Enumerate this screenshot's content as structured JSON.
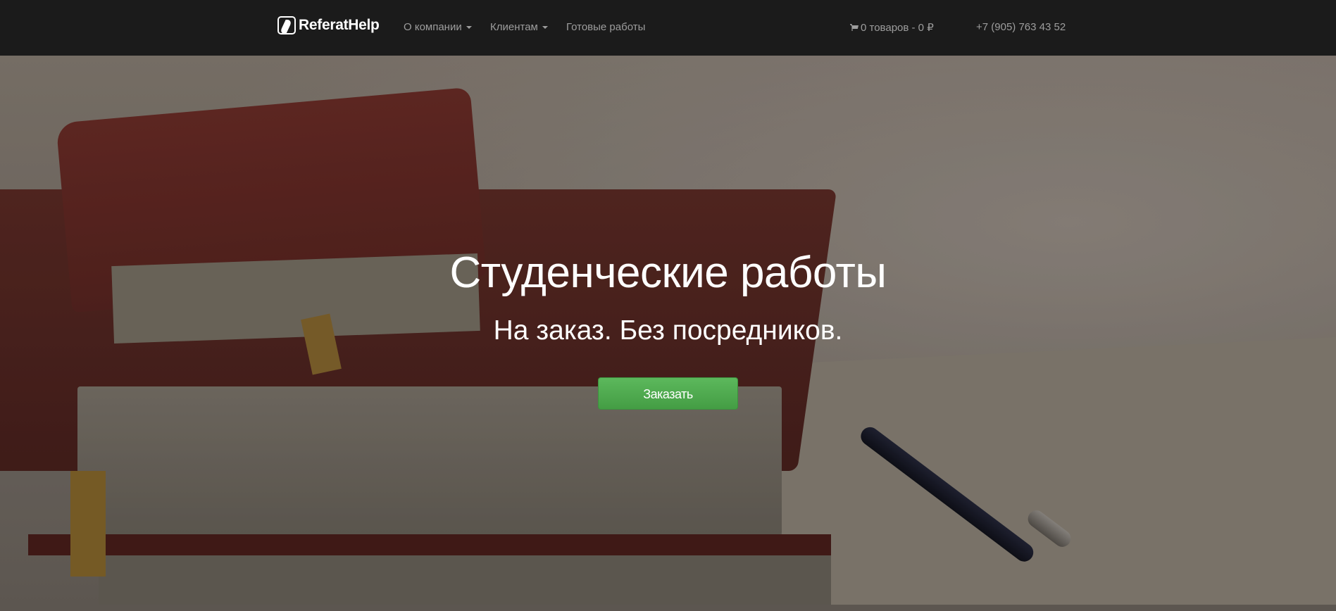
{
  "nav": {
    "brand": "ReferatHelp",
    "items": [
      {
        "label": "О компании",
        "dropdown": true
      },
      {
        "label": "Клиентам",
        "dropdown": true
      },
      {
        "label": "Готовые работы",
        "dropdown": false
      }
    ],
    "cart": "0 товаров - 0 ₽",
    "phone": "+7 (905) 763 43 52"
  },
  "hero": {
    "title": "Студенческие работы",
    "subtitle": "На заказ. Без посредников.",
    "button": "Заказать",
    "button_color": "#5cb85c"
  }
}
